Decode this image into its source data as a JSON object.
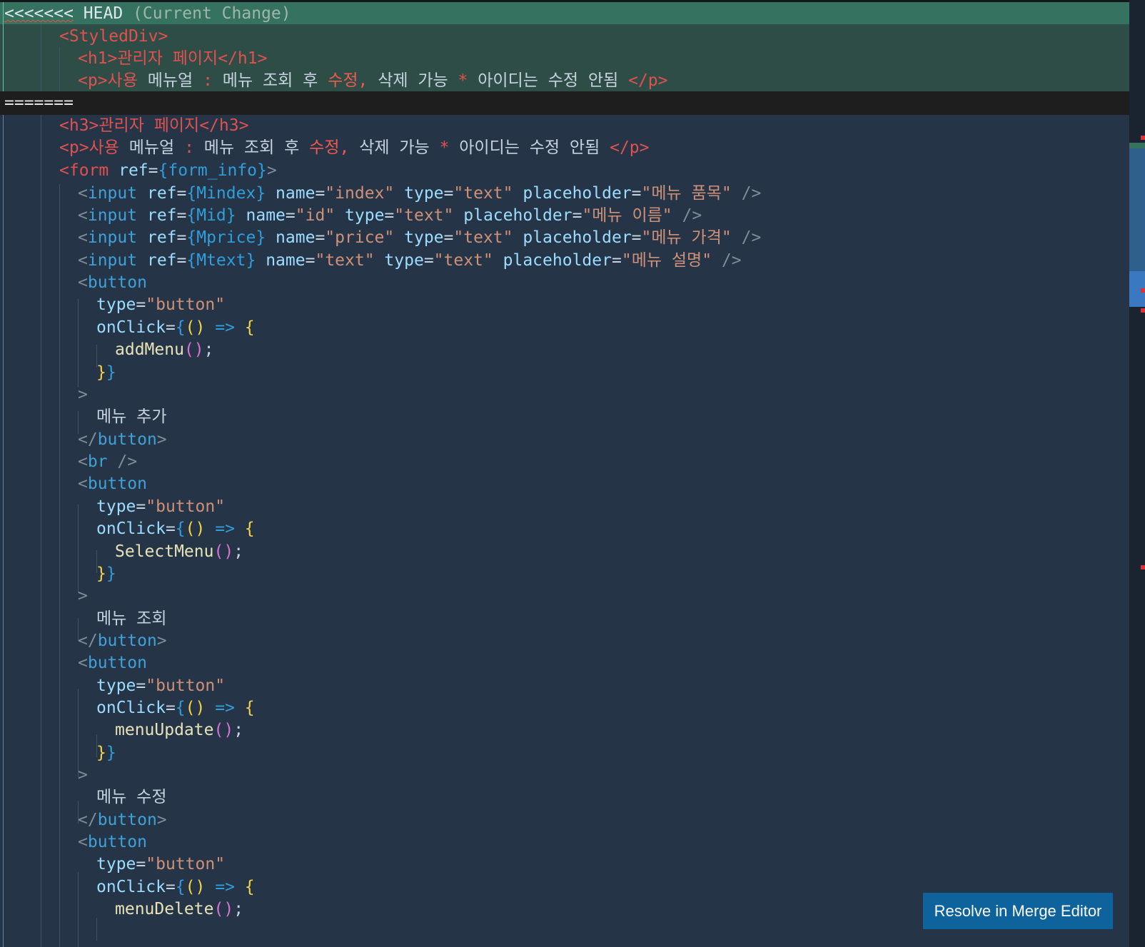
{
  "conflict": {
    "current_marker": "<<<<<<<",
    "current_branch": "HEAD",
    "current_label": "(Current Change)",
    "separator": "======="
  },
  "current": {
    "styled_open": "StyledDiv",
    "h1_tag_open": "<h1>",
    "h1_text": "관리자 페이지",
    "h1_tag_close": "</h1>",
    "p_open": "<p>",
    "p_word1": "사용",
    "p_word2": "메뉴얼",
    "p_colon": ":",
    "p_word3": "메뉴 조회 후",
    "p_edit": "수정,",
    "p_word4": "삭제 가능",
    "p_star": "*",
    "p_word5": "아이디는 수정 안됨",
    "p_close": "</p>"
  },
  "incoming": {
    "h3_open": "<h3>",
    "h3_text": "관리자 페이지",
    "h3_close": "</h3>",
    "p_open": "<p>",
    "p_word1": "사용",
    "p_word2": "메뉴얼",
    "p_colon": ":",
    "p_word3": "메뉴 조회 후",
    "p_edit": "수정,",
    "p_word4": "삭제 가능",
    "p_star": "*",
    "p_word5": "아이디는 수정 안됨",
    "p_close": "</p>",
    "form_tag": "form",
    "form_attr": "ref",
    "form_ref": "form_info",
    "inputs": [
      {
        "ref": "Mindex",
        "name": "index",
        "type": "text",
        "placeholder": "메뉴 품목"
      },
      {
        "ref": "Mid",
        "name": "id",
        "type": "text",
        "placeholder": "메뉴 이름"
      },
      {
        "ref": "Mprice",
        "name": "price",
        "type": "text",
        "placeholder": "메뉴 가격"
      },
      {
        "ref": "Mtext",
        "name": "text",
        "type": "text",
        "placeholder": "메뉴 설명"
      }
    ],
    "buttons": [
      {
        "type": "button",
        "handler": "addMenu",
        "label": "메뉴 추가"
      },
      {
        "type": "button",
        "handler": "SelectMenu",
        "label": "메뉴 조회"
      },
      {
        "type": "button",
        "handler": "menuUpdate",
        "label": "메뉴 수정"
      },
      {
        "type": "button",
        "handler": "menuDelete",
        "label": ""
      }
    ],
    "br_tag": "br"
  },
  "tokens": {
    "input": "input",
    "ref": "ref",
    "name": "name",
    "type": "type",
    "placeholder": "placeholder",
    "button": "button",
    "onclick": "onClick",
    "arrow": "=>"
  },
  "actions": {
    "resolve_label": "Resolve in Merge Editor"
  },
  "colors": {
    "editor_bg": "#253547",
    "current_bg": "#2e4d47",
    "current_header_bg": "#357260",
    "tag": "#e0514f",
    "attribute": "#9cdcfe",
    "string": "#ce9178",
    "button_bg": "#0e639c"
  }
}
